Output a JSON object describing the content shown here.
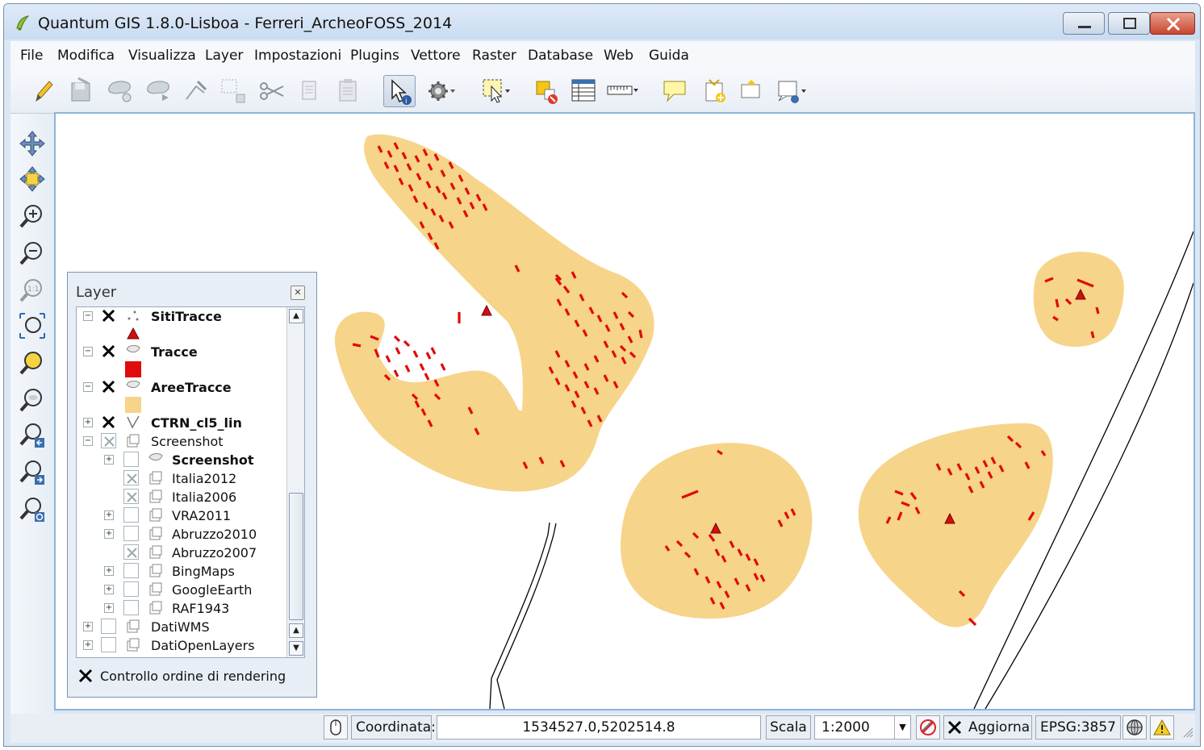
{
  "window": {
    "title": "Quantum GIS 1.8.0-Lisboa - Ferreri_ArcheoFOSS_2014"
  },
  "menu": [
    "File",
    "Modifica",
    "Visualizza",
    "Layer",
    "Impostazioni",
    "Plugins",
    "Vettore",
    "Raster",
    "Database",
    "Web",
    "Guida"
  ],
  "toolbar": {
    "icons": [
      "edit-pencil-icon",
      "save-edits-icon",
      "add-feature-icon",
      "move-feature-icon",
      "node-tool-icon",
      "delete-selected-icon",
      "cut-features-icon",
      "copy-features-icon",
      "paste-features-icon",
      "identify-features-icon",
      "run-action-icon",
      "select-features-icon",
      "deselect-all-icon",
      "open-attribute-table-icon",
      "measure-line-icon",
      "map-tips-icon",
      "new-bookmark-icon",
      "show-bookmarks-icon",
      "text-annotation-icon"
    ]
  },
  "map_nav": {
    "icons": [
      "pan-map-icon",
      "pan-to-selection-icon",
      "zoom-in-icon",
      "zoom-out-icon",
      "zoom-actual-size-icon",
      "zoom-full-icon",
      "zoom-to-selection-icon",
      "zoom-to-layer-icon",
      "zoom-last-icon",
      "zoom-next-icon",
      "refresh-icon"
    ]
  },
  "colors": {
    "area_fill": "#f6d48a",
    "trace_red": "#e00b0b",
    "window_frame": "#dbe7f4"
  },
  "layer_panel": {
    "title": "Layer",
    "rows": [
      {
        "label": "SitiTracce",
        "bold": true,
        "checked": true,
        "expanded": true
      },
      {
        "label": "Tracce",
        "bold": true,
        "checked": true,
        "expanded": true
      },
      {
        "label": "AreeTracce",
        "bold": true,
        "checked": true,
        "expanded": true
      },
      {
        "label": "CTRN_cl5_lin",
        "bold": true,
        "checked": true,
        "expanded": false
      },
      {
        "label": "Screenshot",
        "bold": false,
        "checked": "partial",
        "expanded": true
      },
      {
        "label": "Screenshot",
        "bold": true,
        "checked": false,
        "expanded": false
      },
      {
        "label": "Italia2012",
        "bold": false,
        "checked": "grey"
      },
      {
        "label": "Italia2006",
        "bold": false,
        "checked": "grey"
      },
      {
        "label": "VRA2011",
        "bold": false,
        "checked": false,
        "expanded": false
      },
      {
        "label": "Abruzzo2010",
        "bold": false,
        "checked": false,
        "expanded": false
      },
      {
        "label": "Abruzzo2007",
        "bold": false,
        "checked": "grey"
      },
      {
        "label": "BingMaps",
        "bold": false,
        "checked": false,
        "expanded": false
      },
      {
        "label": "GoogleEarth",
        "bold": false,
        "checked": false,
        "expanded": false
      },
      {
        "label": "RAF1943",
        "bold": false,
        "checked": false,
        "expanded": false
      },
      {
        "label": "DatiWMS",
        "bold": false,
        "checked": false,
        "expanded": false
      },
      {
        "label": "DatiOpenLayers",
        "bold": false,
        "checked": false,
        "expanded": false
      }
    ],
    "render_order_label": "Controllo ordine di rendering",
    "render_order_checked": true
  },
  "statusbar": {
    "coord_label": "Coordinata:",
    "coord_value": "1534527.0,5202514.8",
    "scale_label": "Scala",
    "scale_value": "1:2000",
    "render_label": "Aggiorna",
    "crs": "EPSG:3857"
  }
}
